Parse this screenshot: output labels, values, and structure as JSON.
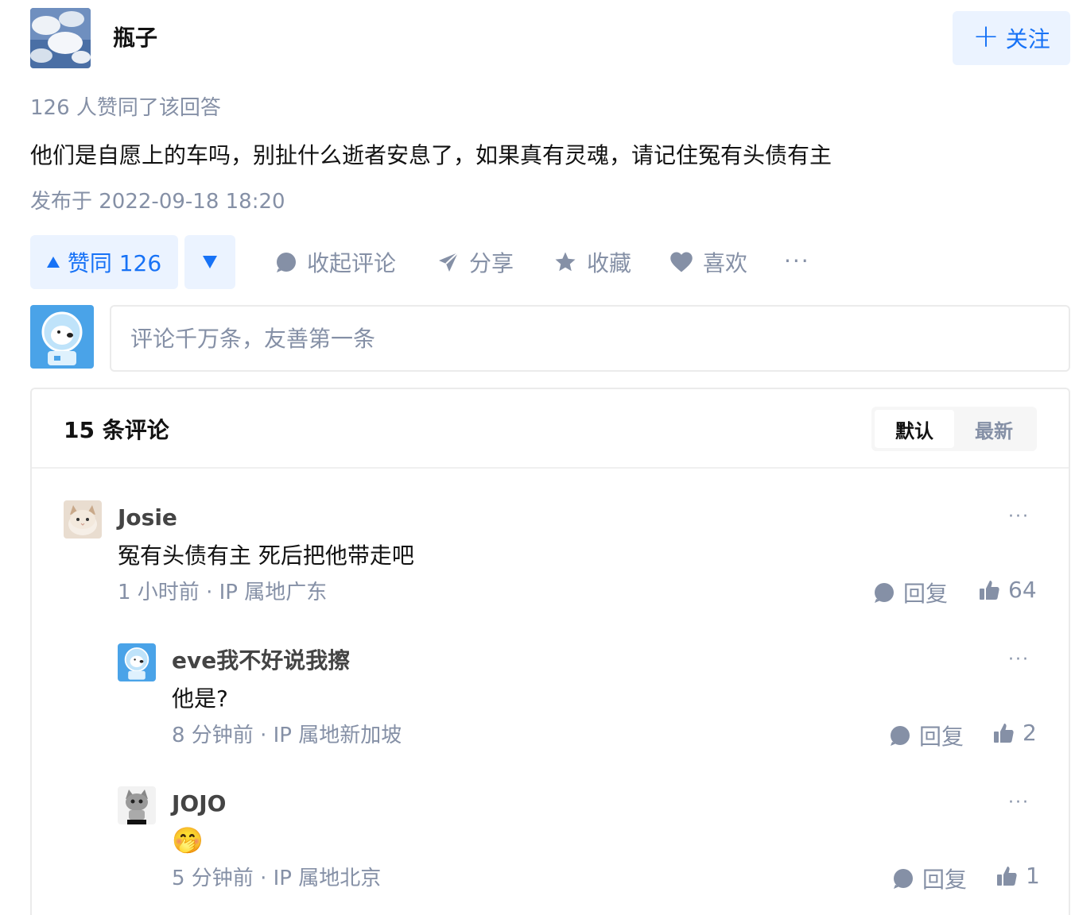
{
  "author": {
    "name": "瓶子",
    "follow_label": "关注",
    "avatar_icon": "cloud-sky-avatar"
  },
  "answer": {
    "vote_summary": "126 人赞同了该回答",
    "text": "他们是自愿上的车吗，别扯什么逝者安息了，如果真有灵魂，请记住冤有头债有主",
    "publish_time": "发布于 2022-09-18 18:20"
  },
  "actions": {
    "upvote_label": "赞同 126",
    "collapse_comments": "收起评论",
    "share": "分享",
    "favorite": "收藏",
    "like": "喜欢",
    "more": "···"
  },
  "comment_box": {
    "placeholder": "评论千万条，友善第一条"
  },
  "comments_panel": {
    "count_label": "15 条评论",
    "sort_options": [
      "默认",
      "最新"
    ],
    "selected_sort": "默认"
  },
  "comments": [
    {
      "user": "Josie",
      "text": "冤有头债有主 死后把他带走吧",
      "meta": "1 小时前 · IP 属地广东",
      "reply_label": "回复",
      "likes": "64",
      "avatar_icon": "cat-avatar"
    },
    {
      "user": "eve我不好说我擦",
      "text": "他是?",
      "meta": "8 分钟前 · IP 属地新加坡",
      "reply_label": "回复",
      "likes": "2",
      "avatar_icon": "astronaut-dog-avatar"
    },
    {
      "user": "JOJO",
      "text": "🤭",
      "meta": "5 分钟前 · IP 属地北京",
      "reply_label": "回复",
      "likes": "1",
      "avatar_icon": "grey-cat-avatar"
    }
  ],
  "colors": {
    "accent": "#1772f6",
    "accent_bg": "#ebf3ff",
    "muted": "#8590a6"
  }
}
